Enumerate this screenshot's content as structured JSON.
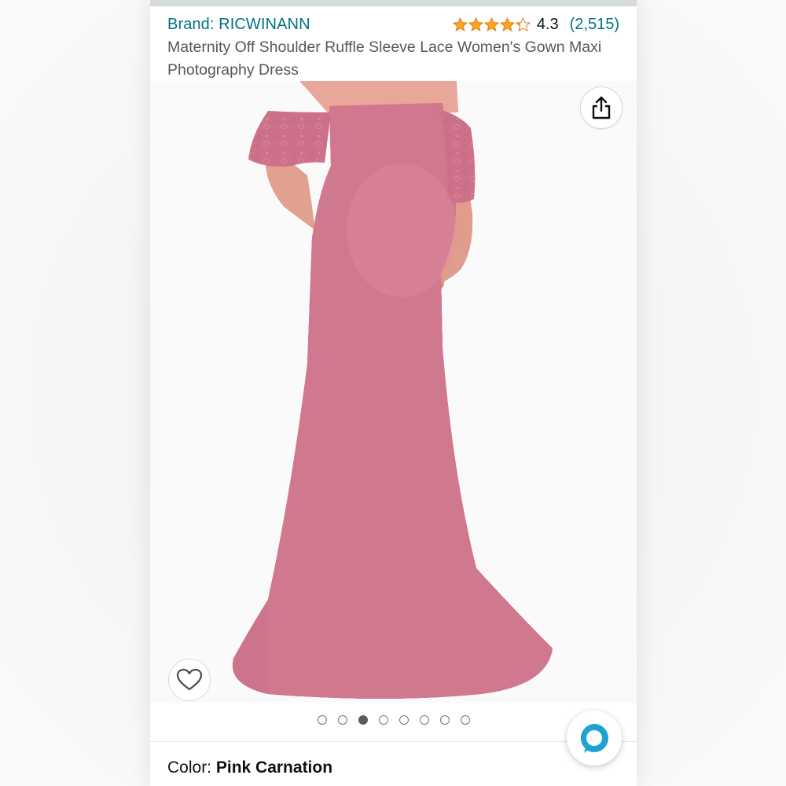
{
  "brand": {
    "text": "Brand: RICWINANN"
  },
  "rating": {
    "value": "4.3",
    "count": "(2,515)",
    "stars": 4.3,
    "star_color": "#ffa41c"
  },
  "product": {
    "title": "Maternity Off Shoulder Ruffle Sleeve Lace Women's Gown Maxi Photography Dress"
  },
  "gallery": {
    "total_images": 8,
    "active_index": 2,
    "dress_color": "#d0788e"
  },
  "color_selection": {
    "label": "Color: ",
    "value": "Pink Carnation"
  },
  "icons": {
    "share": "share-icon",
    "wishlist": "heart-icon",
    "assistant": "alexa-icon"
  },
  "colors": {
    "link": "#007185",
    "text": "#0f1111",
    "secondary": "#565959",
    "alexa": "#1ea2d3"
  }
}
